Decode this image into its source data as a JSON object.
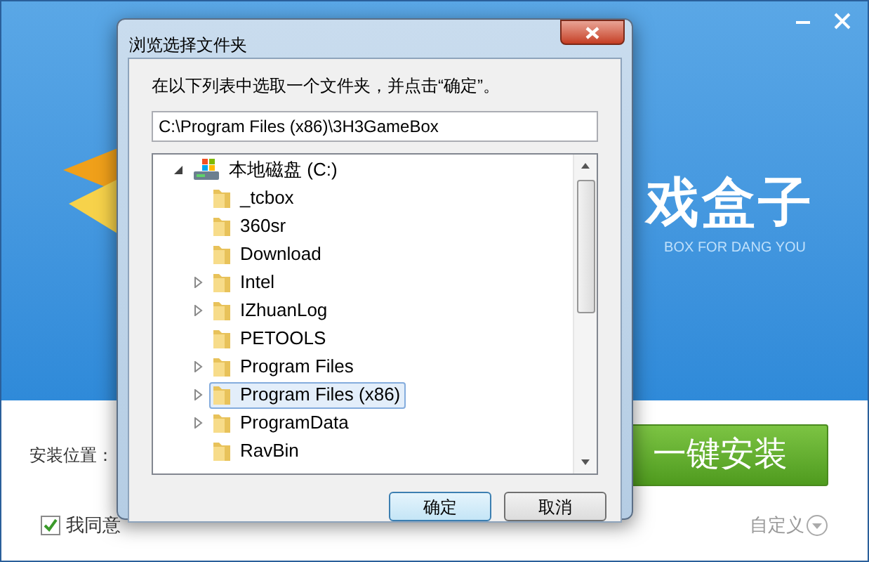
{
  "installer": {
    "brand_title": "戏盒子",
    "brand_subtitle": "BOX FOR DANG YOU",
    "install_location_label": "安装位置：",
    "install_button": "一键安装",
    "agree": {
      "label": "我同意",
      "checked": true
    },
    "customize": "自定义"
  },
  "dialog": {
    "title": "浏览选择文件夹",
    "instruction": "在以下列表中选取一个文件夹，并点击“确定”。",
    "path_value": "C:\\Program Files (x86)\\3H3GameBox",
    "tree": [
      {
        "label": "本地磁盘 (C:)",
        "expanded": true,
        "selected": false,
        "children": [
          {
            "label": "_tcbox",
            "has_children": false,
            "selected": false
          },
          {
            "label": "360sr",
            "has_children": false,
            "selected": false
          },
          {
            "label": "Download",
            "has_children": false,
            "selected": false
          },
          {
            "label": "Intel",
            "has_children": true,
            "selected": false
          },
          {
            "label": "IZhuanLog",
            "has_children": true,
            "selected": false
          },
          {
            "label": "PETOOLS",
            "has_children": false,
            "selected": false
          },
          {
            "label": "Program Files",
            "has_children": true,
            "selected": false
          },
          {
            "label": "Program Files (x86)",
            "has_children": true,
            "selected": true
          },
          {
            "label": "ProgramData",
            "has_children": true,
            "selected": false
          },
          {
            "label": "RavBin",
            "has_children": false,
            "selected": false
          }
        ]
      }
    ],
    "buttons": [
      {
        "label": "确定",
        "default": true
      },
      {
        "label": "取消",
        "default": false
      }
    ]
  }
}
